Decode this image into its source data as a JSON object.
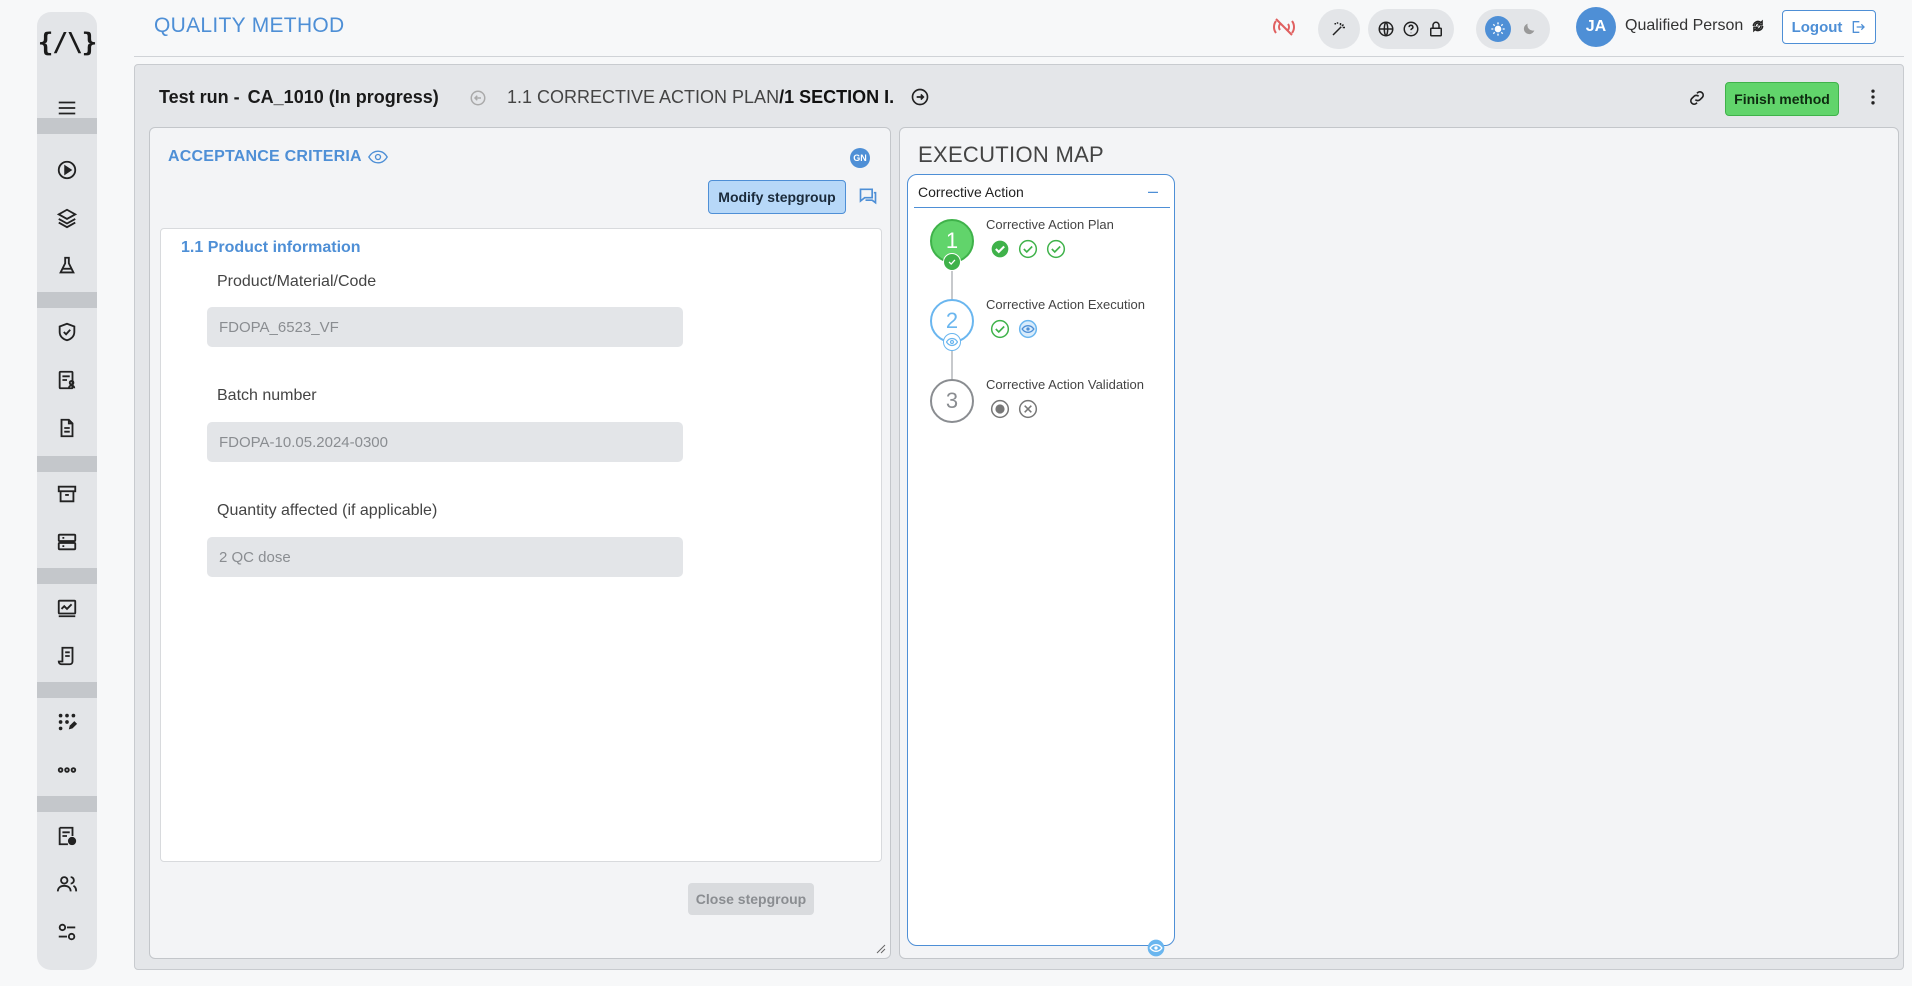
{
  "app": {
    "title": "QUALITY METHOD",
    "logo": "{/\\}"
  },
  "sidebar": {
    "icons": [
      "menu-icon",
      "play-icon",
      "layers-icon",
      "flask-icon",
      "shield-check-icon",
      "form-person-icon",
      "document-icon",
      "archive-icon",
      "server-icon",
      "monitor-chart-icon",
      "receipt-icon",
      "grid-edit-icon",
      "more-icon",
      "report-clock-icon",
      "users-icon",
      "sliders-icon"
    ]
  },
  "header": {
    "user_initials": "JA",
    "user_name": "Qualified Person",
    "logout_label": "Logout"
  },
  "run": {
    "title_prefix": "Test run -",
    "title_name": "CA_1010 (In progress)",
    "breadcrumb_step": "1.1 CORRECTIVE ACTION PLAN",
    "breadcrumb_sep": "/",
    "breadcrumb_section": "1 SECTION I.",
    "finish_label": "Finish method"
  },
  "acceptance": {
    "title": "ACCEPTANCE CRITERIA",
    "badge": "GN",
    "modify_label": "Modify stepgroup",
    "close_label": "Close stepgroup",
    "section_title": "1.1 Product information",
    "fields": [
      {
        "label": "Product/Material/Code",
        "value": "FDOPA_6523_VF"
      },
      {
        "label": "Batch number",
        "value": "FDOPA-10.05.2024-0300"
      },
      {
        "label": "Quantity affected (if applicable)",
        "value": "2 QC dose"
      }
    ]
  },
  "execution_map": {
    "title": "EXECUTION MAP",
    "group": "Corrective Action",
    "collapse": "–",
    "steps": [
      {
        "number": "1",
        "label": "Corrective Action Plan",
        "status": "completed"
      },
      {
        "number": "2",
        "label": "Corrective Action Execution",
        "status": "in-review"
      },
      {
        "number": "3",
        "label": "Corrective Action Validation",
        "status": "pending"
      }
    ]
  },
  "colors": {
    "accent": "#4e8fd6",
    "success": "#61d46b",
    "success_dark": "#3fb24a",
    "muted": "#8a8d91"
  }
}
